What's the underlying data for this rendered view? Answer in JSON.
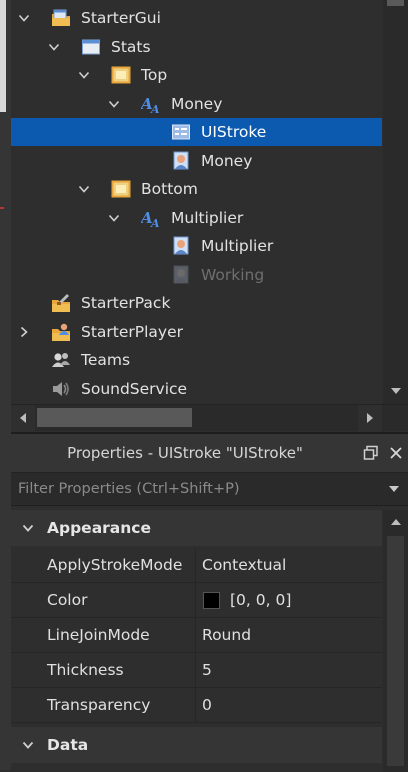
{
  "explorer": {
    "items": [
      {
        "label": "StarterGui",
        "icon": "startergui-icon",
        "expanded": true
      },
      {
        "label": "Stats",
        "icon": "screengui-icon",
        "expanded": true
      },
      {
        "label": "Top",
        "icon": "frame-icon",
        "expanded": true
      },
      {
        "label": "Money",
        "icon": "textlabel-icon",
        "expanded": true
      },
      {
        "label": "UIStroke",
        "icon": "uistroke-icon",
        "selected": true
      },
      {
        "label": "Money",
        "icon": "localscript-icon"
      },
      {
        "label": "Bottom",
        "icon": "frame-icon",
        "expanded": true
      },
      {
        "label": "Multiplier",
        "icon": "textlabel-icon",
        "expanded": true
      },
      {
        "label": "Multiplier",
        "icon": "localscript-icon"
      },
      {
        "label": "Working",
        "icon": "localscript-icon",
        "disabled": true
      },
      {
        "label": "StarterPack",
        "icon": "starterpack-icon"
      },
      {
        "label": "StarterPlayer",
        "icon": "starterplayer-icon",
        "expanded": false
      },
      {
        "label": "Teams",
        "icon": "teams-icon"
      },
      {
        "label": "SoundService",
        "icon": "soundservice-icon"
      }
    ]
  },
  "properties": {
    "title": "Properties - UIStroke \"UIStroke\"",
    "filter_placeholder": "Filter Properties (Ctrl+Shift+P)",
    "categories": [
      {
        "label": "Appearance",
        "rows": [
          {
            "name": "ApplyStrokeMode",
            "value": "Contextual"
          },
          {
            "name": "Color",
            "value": "[0, 0, 0]",
            "swatch": "#000000"
          },
          {
            "name": "LineJoinMode",
            "value": "Round"
          },
          {
            "name": "Thickness",
            "value": "5"
          },
          {
            "name": "Transparency",
            "value": "0"
          }
        ]
      },
      {
        "label": "Data",
        "rows": []
      }
    ]
  },
  "colors": {
    "selection": "#0b5aaf",
    "background": "#2e2e2e",
    "header": "#353535"
  }
}
